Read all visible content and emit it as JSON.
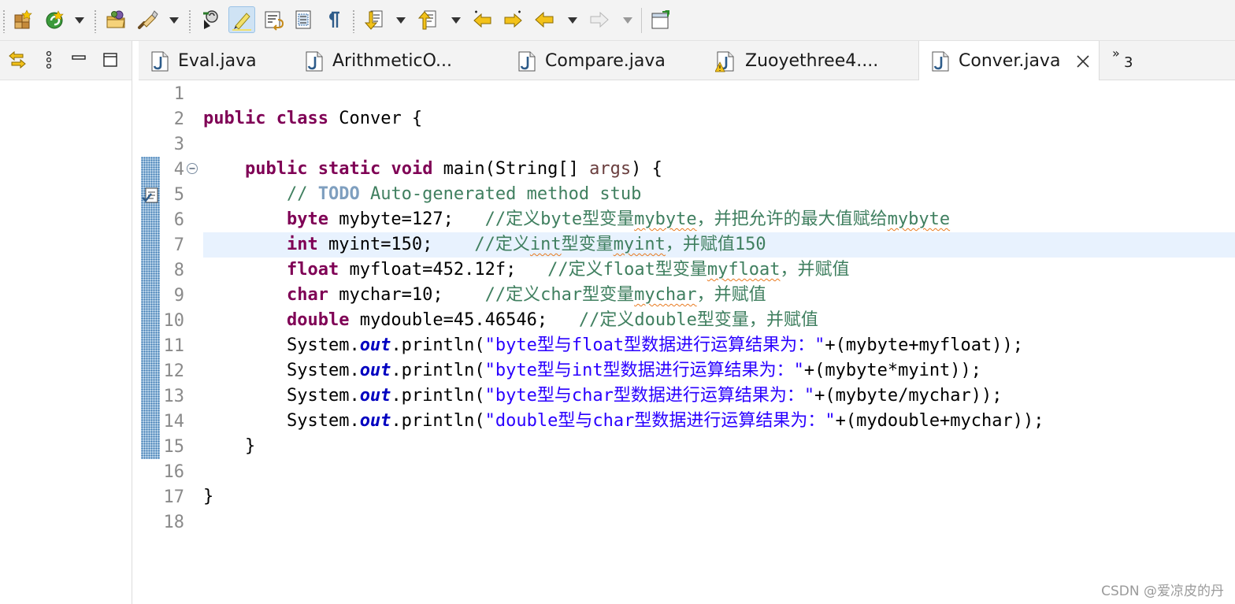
{
  "toolbar": {
    "buttons": [
      {
        "name": "new-java-package-icon"
      },
      {
        "name": "run-last-tool-icon"
      },
      {
        "name": "open-type-icon"
      },
      {
        "name": "search-references-icon"
      },
      {
        "name": "open-task-icon"
      },
      {
        "name": "toggle-mark-occurrences-icon",
        "active": true
      },
      {
        "name": "toggle-word-wrap-icon"
      },
      {
        "name": "toggle-block-selection-icon"
      },
      {
        "name": "show-whitespace-icon"
      },
      {
        "name": "next-annotation-icon"
      },
      {
        "name": "previous-annotation-icon"
      },
      {
        "name": "last-edit-location-icon"
      },
      {
        "name": "next-edit-location-icon"
      },
      {
        "name": "back-icon"
      },
      {
        "name": "forward-icon"
      },
      {
        "name": "open-perspective-icon"
      }
    ]
  },
  "left_view": {
    "buttons": [
      "link-with-editor-icon",
      "view-menu-icon",
      "minimize-icon",
      "maximize-icon"
    ]
  },
  "tabs": [
    {
      "label": "Eval.java",
      "icon": "java-file-icon",
      "active": false
    },
    {
      "label": "ArithmeticO...",
      "icon": "java-file-icon",
      "active": false
    },
    {
      "label": "Compare.java",
      "icon": "java-file-icon",
      "active": false
    },
    {
      "label": "Zuoyethree4....",
      "icon": "java-file-warning-icon",
      "active": false
    },
    {
      "label": "Conver.java",
      "icon": "java-file-icon",
      "active": true
    }
  ],
  "tab_overflow": {
    "count": "3"
  },
  "editor": {
    "line_numbers": [
      "1",
      "2",
      "3",
      "4",
      "5",
      "6",
      "7",
      "8",
      "9",
      "10",
      "11",
      "12",
      "13",
      "14",
      "15",
      "16",
      "17",
      "18"
    ],
    "current_line": 7,
    "code": {
      "l2": {
        "kw1": "public",
        "kw2": "class",
        "rest": " Conver {"
      },
      "l4": {
        "kw1": "public",
        "kw2": "static",
        "kw3": "void",
        "mid": " main(String[] ",
        "param": "args",
        "end": ") {"
      },
      "l5": {
        "c1": "// ",
        "todo": "TODO",
        "c2": " Auto-generated method stub"
      },
      "l6": {
        "kw": "byte",
        "code": " mybyte=127;   ",
        "c1": "//定义byte型变量",
        "sq": "mybyte",
        "c2": "，并把允许的最大值赋给",
        "sq2": "mybyte"
      },
      "l7": {
        "kw": "int",
        "code": " myint=150;    ",
        "c1": "//定义",
        "sq": "int",
        "c2": "型变量",
        "sq2": "myint",
        "c3": "，并赋值150"
      },
      "l8": {
        "kw": "float",
        "code": " myfloat=452.12f;   ",
        "c1": "//定义float型变量",
        "sq": "myfloat",
        "c2": "，并赋值"
      },
      "l9": {
        "kw": "char",
        "code": " mychar=10;    ",
        "c1": "//定义char型变量",
        "sq": "mychar",
        "c2": "，并赋值"
      },
      "l10": {
        "kw": "double",
        "code": " mydouble=45.46546;   ",
        "c1": "//定义double型变量，并赋值"
      },
      "l11": {
        "a": "System.",
        "f": "out",
        "b": ".println(",
        "s": "\"byte型与float型数据进行运算结果为：\"",
        "c": "+(mybyte+myfloat));"
      },
      "l12": {
        "a": "System.",
        "f": "out",
        "b": ".println(",
        "s": "\"byte型与int型数据进行运算结果为：\"",
        "c": "+(mybyte*myint));"
      },
      "l13": {
        "a": "System.",
        "f": "out",
        "b": ".println(",
        "s": "\"byte型与char型数据进行运算结果为：\"",
        "c": "+(mybyte/mychar));"
      },
      "l14": {
        "a": "System.",
        "f": "out",
        "b": ".println(",
        "s": "\"double型与char型数据进行运算结果为：\"",
        "c": "+(mydouble+mychar));"
      },
      "l15": "}",
      "l17": "}"
    }
  },
  "watermark": "CSDN @爱凉皮的丹",
  "colors": {
    "keyword": "#7f0055",
    "comment": "#3f7f5f",
    "string": "#2a00ff",
    "field": "#0000c0",
    "current_line": "#e8f2fe"
  }
}
